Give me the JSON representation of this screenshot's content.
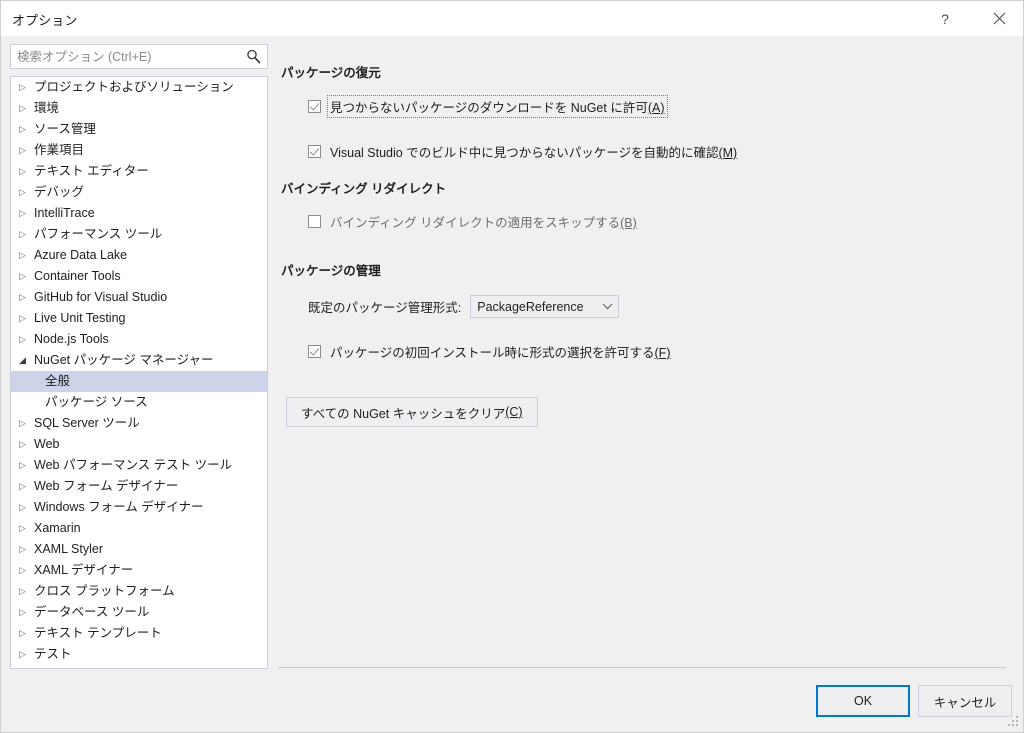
{
  "window": {
    "title": "オプション",
    "help_icon": "?",
    "help_name": "help-icon",
    "close_name": "close-icon"
  },
  "search": {
    "placeholder": "検索オプション (Ctrl+E)",
    "value": "",
    "icon": "search-icon"
  },
  "tree": {
    "items": [
      {
        "label": "プロジェクトおよびソリューション",
        "level": 1,
        "expandable": true,
        "expanded": false,
        "selected": false
      },
      {
        "label": "環境",
        "level": 1,
        "expandable": true,
        "expanded": false,
        "selected": false
      },
      {
        "label": "ソース管理",
        "level": 1,
        "expandable": true,
        "expanded": false,
        "selected": false
      },
      {
        "label": "作業項目",
        "level": 1,
        "expandable": true,
        "expanded": false,
        "selected": false
      },
      {
        "label": "テキスト エディター",
        "level": 1,
        "expandable": true,
        "expanded": false,
        "selected": false
      },
      {
        "label": "デバッグ",
        "level": 1,
        "expandable": true,
        "expanded": false,
        "selected": false
      },
      {
        "label": "IntelliTrace",
        "level": 1,
        "expandable": true,
        "expanded": false,
        "selected": false
      },
      {
        "label": "パフォーマンス ツール",
        "level": 1,
        "expandable": true,
        "expanded": false,
        "selected": false
      },
      {
        "label": "Azure Data Lake",
        "level": 1,
        "expandable": true,
        "expanded": false,
        "selected": false
      },
      {
        "label": "Container Tools",
        "level": 1,
        "expandable": true,
        "expanded": false,
        "selected": false
      },
      {
        "label": "GitHub for Visual Studio",
        "level": 1,
        "expandable": true,
        "expanded": false,
        "selected": false
      },
      {
        "label": "Live Unit Testing",
        "level": 1,
        "expandable": true,
        "expanded": false,
        "selected": false
      },
      {
        "label": "Node.js Tools",
        "level": 1,
        "expandable": true,
        "expanded": false,
        "selected": false
      },
      {
        "label": "NuGet パッケージ マネージャー",
        "level": 1,
        "expandable": true,
        "expanded": true,
        "selected": false
      },
      {
        "label": "全般",
        "level": 2,
        "expandable": false,
        "expanded": false,
        "selected": true
      },
      {
        "label": "パッケージ ソース",
        "level": 2,
        "expandable": false,
        "expanded": false,
        "selected": false
      },
      {
        "label": "SQL Server ツール",
        "level": 1,
        "expandable": true,
        "expanded": false,
        "selected": false
      },
      {
        "label": "Web",
        "level": 1,
        "expandable": true,
        "expanded": false,
        "selected": false
      },
      {
        "label": "Web パフォーマンス テスト ツール",
        "level": 1,
        "expandable": true,
        "expanded": false,
        "selected": false
      },
      {
        "label": "Web フォーム デザイナー",
        "level": 1,
        "expandable": true,
        "expanded": false,
        "selected": false
      },
      {
        "label": "Windows フォーム デザイナー",
        "level": 1,
        "expandable": true,
        "expanded": false,
        "selected": false
      },
      {
        "label": "Xamarin",
        "level": 1,
        "expandable": true,
        "expanded": false,
        "selected": false
      },
      {
        "label": "XAML Styler",
        "level": 1,
        "expandable": true,
        "expanded": false,
        "selected": false
      },
      {
        "label": "XAML デザイナー",
        "level": 1,
        "expandable": true,
        "expanded": false,
        "selected": false
      },
      {
        "label": "クロス プラットフォーム",
        "level": 1,
        "expandable": true,
        "expanded": false,
        "selected": false
      },
      {
        "label": "データベース ツール",
        "level": 1,
        "expandable": true,
        "expanded": false,
        "selected": false
      },
      {
        "label": "テキスト テンプレート",
        "level": 1,
        "expandable": true,
        "expanded": false,
        "selected": false
      },
      {
        "label": "テスト",
        "level": 1,
        "expandable": true,
        "expanded": false,
        "selected": false
      }
    ]
  },
  "content": {
    "sections": {
      "restore": {
        "heading": "パッケージの復元",
        "cb_allow_download": {
          "text": "見つからないパッケージのダウンロードを NuGet に許可",
          "accel": "(A)",
          "checked": true
        },
        "cb_auto_check": {
          "text": "Visual Studio でのビルド中に見つからないパッケージを自動的に確認",
          "accel": "(M)",
          "checked": true
        }
      },
      "binding": {
        "heading": "バインディング リダイレクト",
        "cb_skip": {
          "text": "バインディング リダイレクトの適用をスキップする",
          "accel": "(B)",
          "checked": false
        }
      },
      "manage": {
        "heading": "パッケージの管理",
        "format_label": "既定のパッケージ管理形式:",
        "format_value": "PackageReference",
        "cb_allow_format_choice": {
          "text": "パッケージの初回インストール時に形式の選択を許可する",
          "accel": "(F)",
          "checked": true
        },
        "clear_cache_button": {
          "text": "すべての NuGet キャッシュをクリア",
          "accel": "(C)"
        }
      }
    }
  },
  "footer": {
    "ok": "OK",
    "cancel": "キャンセル"
  },
  "colors": {
    "accent": "#0078d7",
    "tree_selection": "#cdd3e8",
    "dialog_bg": "#f0f0f0",
    "control_bg": "#efeff2",
    "control_border": "#cccedb"
  }
}
